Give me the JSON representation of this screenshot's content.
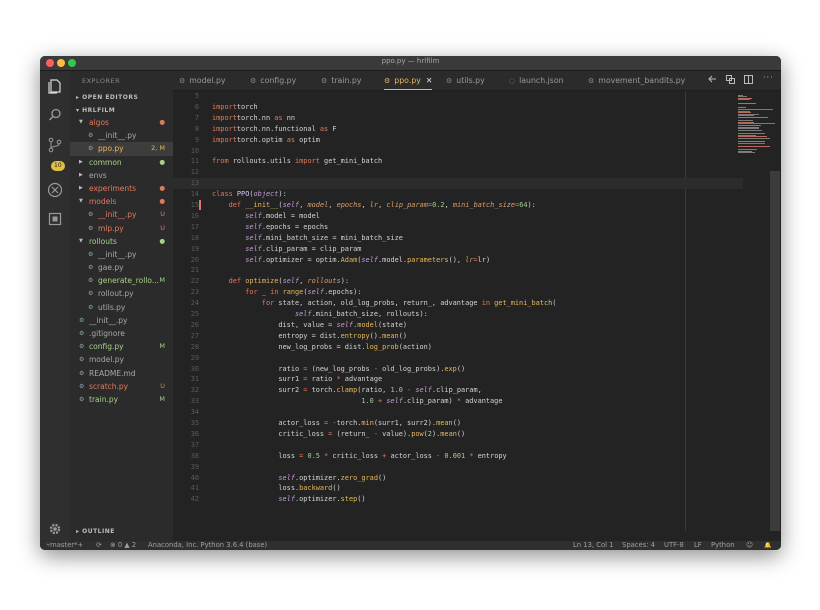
{
  "window": {
    "title": "ppo.py — hrlfilm"
  },
  "traffic_lights": {
    "close": "#fc605c",
    "minimize": "#fdbc40",
    "maximize": "#34c84a"
  },
  "activity_bar": {
    "icons": [
      "files-icon",
      "search-icon",
      "source-control-icon",
      "debug-icon",
      "extensions-icon",
      "settings-gear-icon"
    ],
    "scm_badge": "10"
  },
  "sidebar": {
    "explorer_title": "EXPLORER",
    "open_editors": "OPEN EDITORS",
    "project": "HRLFILM",
    "outline": "OUTLINE",
    "items": [
      {
        "name": "algos",
        "type": "folder",
        "open": true,
        "indent": 1,
        "color": "#e07a5f",
        "status": "●",
        "status_color": "#e07a5f"
      },
      {
        "name": "__init__.py",
        "type": "file",
        "indent": 2,
        "color": "#a8a8a8",
        "status": "",
        "status_color": ""
      },
      {
        "name": "ppo.py",
        "type": "file",
        "indent": 2,
        "color": "#e6b85c",
        "status": "2, M",
        "status_color": "#e6b85c",
        "selected": true
      },
      {
        "name": "common",
        "type": "folder",
        "open": false,
        "indent": 1,
        "color": "#a6d189",
        "status": "●",
        "status_color": "#a6d189"
      },
      {
        "name": "envs",
        "type": "folder",
        "open": false,
        "indent": 1,
        "color": "#a8a8a8",
        "status": "",
        "status_color": ""
      },
      {
        "name": "experiments",
        "type": "folder",
        "open": false,
        "indent": 1,
        "color": "#e07a5f",
        "status": "●",
        "status_color": "#e07a5f"
      },
      {
        "name": "models",
        "type": "folder",
        "open": true,
        "indent": 1,
        "color": "#e07a5f",
        "status": "●",
        "status_color": "#e07a5f"
      },
      {
        "name": "__init__.py",
        "type": "file",
        "indent": 2,
        "color": "#e07a5f",
        "status": "U",
        "status_color": "#e07a5f"
      },
      {
        "name": "mlp.py",
        "type": "file",
        "indent": 2,
        "color": "#e07a5f",
        "status": "U",
        "status_color": "#e07a5f"
      },
      {
        "name": "rollouts",
        "type": "folder",
        "open": true,
        "indent": 1,
        "color": "#a6d189",
        "status": "●",
        "status_color": "#a6d189"
      },
      {
        "name": "__init__.py",
        "type": "file",
        "indent": 2,
        "color": "#a8a8a8",
        "status": "",
        "status_color": ""
      },
      {
        "name": "gae.py",
        "type": "file",
        "indent": 2,
        "color": "#a8a8a8",
        "status": "",
        "status_color": ""
      },
      {
        "name": "generate_rollo...",
        "type": "file",
        "indent": 2,
        "color": "#a6d189",
        "status": "M",
        "status_color": "#a6d189"
      },
      {
        "name": "rollout.py",
        "type": "file",
        "indent": 2,
        "color": "#a8a8a8",
        "status": "",
        "status_color": ""
      },
      {
        "name": "utils.py",
        "type": "file",
        "indent": 2,
        "color": "#a8a8a8",
        "status": "",
        "status_color": ""
      },
      {
        "name": "__init__.py",
        "type": "file",
        "indent": 1,
        "color": "#a8a8a8",
        "status": "",
        "status_color": ""
      },
      {
        "name": ".gitignore",
        "type": "file",
        "indent": 1,
        "color": "#a8a8a8",
        "status": "",
        "status_color": ""
      },
      {
        "name": "config.py",
        "type": "file",
        "indent": 1,
        "color": "#a6d189",
        "status": "M",
        "status_color": "#a6d189"
      },
      {
        "name": "model.py",
        "type": "file",
        "indent": 1,
        "color": "#a8a8a8",
        "status": "",
        "status_color": ""
      },
      {
        "name": "README.md",
        "type": "file",
        "indent": 1,
        "color": "#a8a8a8",
        "status": "",
        "status_color": ""
      },
      {
        "name": "scratch.py",
        "type": "file",
        "indent": 1,
        "color": "#e07a5f",
        "status": "U",
        "status_color": "#e07a5f"
      },
      {
        "name": "train.py",
        "type": "file",
        "indent": 1,
        "color": "#a6d189",
        "status": "M",
        "status_color": "#a6d189"
      }
    ]
  },
  "tabs": [
    {
      "label": "model.py",
      "active": false
    },
    {
      "label": "config.py",
      "active": false
    },
    {
      "label": "train.py",
      "active": false
    },
    {
      "label": "ppo.py",
      "active": true
    },
    {
      "label": "utils.py",
      "active": false
    },
    {
      "label": "launch.json",
      "active": false
    },
    {
      "label": "movement_bandits.py",
      "active": false
    }
  ],
  "tab_actions": [
    "more-tab-icon",
    "open-changes-icon",
    "split-editor-icon",
    "more-actions-icon"
  ],
  "code": {
    "current_line": 13,
    "modified_lines": [
      15
    ],
    "lines": [
      {
        "n": 5,
        "seg": []
      },
      {
        "n": 6,
        "seg": [
          [
            "kw",
            "import"
          ],
          [
            "",
            "torch"
          ]
        ]
      },
      {
        "n": 7,
        "seg": [
          [
            "kw",
            "import"
          ],
          [
            "",
            "torch.nn "
          ],
          [
            "kw",
            "as"
          ],
          [
            "",
            " nn"
          ]
        ]
      },
      {
        "n": 8,
        "seg": [
          [
            "kw",
            "import"
          ],
          [
            "",
            "torch.nn.functional "
          ],
          [
            "kw",
            "as"
          ],
          [
            "",
            " F"
          ]
        ]
      },
      {
        "n": 9,
        "seg": [
          [
            "kw",
            "import"
          ],
          [
            "",
            "torch.optim "
          ],
          [
            "kw",
            "as"
          ],
          [
            "",
            " optim"
          ]
        ]
      },
      {
        "n": 10,
        "seg": []
      },
      {
        "n": 11,
        "seg": [
          [
            "kw",
            "from"
          ],
          [
            "",
            " rollouts.utils "
          ],
          [
            "kw",
            "import"
          ],
          [
            "",
            " get_mini_batch"
          ]
        ]
      },
      {
        "n": 12,
        "seg": []
      },
      {
        "n": 13,
        "seg": []
      },
      {
        "n": 14,
        "seg": [
          [
            "kw",
            "class"
          ],
          [
            "",
            " "
          ],
          [
            "cl",
            "PPO"
          ],
          [
            "",
            "("
          ],
          [
            "sf",
            "object"
          ],
          [
            "",
            "):"
          ]
        ]
      },
      {
        "n": 15,
        "seg": [
          [
            "",
            "    "
          ],
          [
            "kw",
            "def"
          ],
          [
            "",
            " "
          ],
          [
            "fn",
            "__init__"
          ],
          [
            "",
            "("
          ],
          [
            "sf",
            "self"
          ],
          [
            "",
            ", "
          ],
          [
            "pm",
            "model"
          ],
          [
            "",
            ", "
          ],
          [
            "pm",
            "epochs"
          ],
          [
            "",
            ", "
          ],
          [
            "pm",
            "lr"
          ],
          [
            "",
            ", "
          ],
          [
            "pm",
            "clip_param"
          ],
          [
            "op",
            "="
          ],
          [
            "nm",
            "0.2"
          ],
          [
            "",
            ", "
          ],
          [
            "pm",
            "mini_batch_size"
          ],
          [
            "op",
            "="
          ],
          [
            "nm",
            "64"
          ],
          [
            "",
            "):"
          ]
        ]
      },
      {
        "n": 16,
        "seg": [
          [
            "",
            "        "
          ],
          [
            "sf",
            "self"
          ],
          [
            "",
            ".model = model"
          ]
        ]
      },
      {
        "n": 17,
        "seg": [
          [
            "",
            "        "
          ],
          [
            "sf",
            "self"
          ],
          [
            "",
            ".epochs = epochs"
          ]
        ]
      },
      {
        "n": 18,
        "seg": [
          [
            "",
            "        "
          ],
          [
            "sf",
            "self"
          ],
          [
            "",
            ".mini_batch_size = mini_batch_size"
          ]
        ]
      },
      {
        "n": 19,
        "seg": [
          [
            "",
            "        "
          ],
          [
            "sf",
            "self"
          ],
          [
            "",
            ".clip_param = clip_param"
          ]
        ]
      },
      {
        "n": 20,
        "seg": [
          [
            "",
            "        "
          ],
          [
            "sf",
            "self"
          ],
          [
            "",
            ".optimizer = optim."
          ],
          [
            "fn",
            "Adam"
          ],
          [
            "",
            "("
          ],
          [
            "sf",
            "self"
          ],
          [
            "",
            ".model."
          ],
          [
            "fn",
            "parameters"
          ],
          [
            "",
            "(), "
          ],
          [
            "pm",
            "lr"
          ],
          [
            "op",
            "="
          ],
          [
            "",
            "lr)"
          ]
        ]
      },
      {
        "n": 21,
        "seg": []
      },
      {
        "n": 22,
        "seg": [
          [
            "",
            "    "
          ],
          [
            "kw",
            "def"
          ],
          [
            "",
            " "
          ],
          [
            "fn",
            "optimize"
          ],
          [
            "",
            "("
          ],
          [
            "sf",
            "self"
          ],
          [
            "",
            ", "
          ],
          [
            "pm",
            "rollouts"
          ],
          [
            "",
            "):"
          ]
        ]
      },
      {
        "n": 23,
        "seg": [
          [
            "",
            "        "
          ],
          [
            "kw",
            "for"
          ],
          [
            "",
            " _ "
          ],
          [
            "kw",
            "in"
          ],
          [
            "",
            " "
          ],
          [
            "fn",
            "range"
          ],
          [
            "",
            "("
          ],
          [
            "sf",
            "self"
          ],
          [
            "",
            ".epochs):"
          ]
        ]
      },
      {
        "n": 24,
        "seg": [
          [
            "",
            "            "
          ],
          [
            "kw",
            "for"
          ],
          [
            "",
            " state, action, old_log_probs, return_, advantage "
          ],
          [
            "kw",
            "in"
          ],
          [
            "",
            " "
          ],
          [
            "fn",
            "get_mini_batch"
          ],
          [
            "",
            "("
          ]
        ]
      },
      {
        "n": 25,
        "seg": [
          [
            "",
            "                    "
          ],
          [
            "sf",
            "self"
          ],
          [
            "",
            ".mini_batch_size, rollouts):"
          ]
        ]
      },
      {
        "n": 26,
        "seg": [
          [
            "",
            "                dist, value = "
          ],
          [
            "sf",
            "self"
          ],
          [
            "",
            "."
          ],
          [
            "fn",
            "model"
          ],
          [
            "",
            "(state)"
          ]
        ]
      },
      {
        "n": 27,
        "seg": [
          [
            "",
            "                entropy = dist."
          ],
          [
            "fn",
            "entropy"
          ],
          [
            "",
            "()."
          ],
          [
            "fn",
            "mean"
          ],
          [
            "",
            "()"
          ]
        ]
      },
      {
        "n": 28,
        "seg": [
          [
            "",
            "                new_log_probs = dist."
          ],
          [
            "fn",
            "log_prob"
          ],
          [
            "",
            "(action)"
          ]
        ]
      },
      {
        "n": 29,
        "seg": []
      },
      {
        "n": 30,
        "seg": [
          [
            "",
            "                ratio "
          ],
          [
            "op",
            "="
          ],
          [
            "",
            " (new_log_probs "
          ],
          [
            "op",
            "-"
          ],
          [
            "",
            " old_log_probs)."
          ],
          [
            "fn",
            "exp"
          ],
          [
            "",
            "()"
          ]
        ]
      },
      {
        "n": 31,
        "seg": [
          [
            "",
            "                surr1 "
          ],
          [
            "op",
            "="
          ],
          [
            "",
            " ratio "
          ],
          [
            "op",
            "*"
          ],
          [
            "",
            " advantage"
          ]
        ]
      },
      {
        "n": 32,
        "seg": [
          [
            "",
            "                surr2 "
          ],
          [
            "op",
            "="
          ],
          [
            "",
            " torch."
          ],
          [
            "fn",
            "clamp"
          ],
          [
            "",
            "(ratio, "
          ],
          [
            "nm",
            "1.0"
          ],
          [
            "",
            " "
          ],
          [
            "op",
            "-"
          ],
          [
            "",
            " "
          ],
          [
            "sf",
            "self"
          ],
          [
            "",
            ".clip_param,"
          ]
        ]
      },
      {
        "n": 33,
        "seg": [
          [
            "",
            "                                    "
          ],
          [
            "nm",
            "1.0"
          ],
          [
            "",
            " "
          ],
          [
            "op",
            "+"
          ],
          [
            "",
            " "
          ],
          [
            "sf",
            "self"
          ],
          [
            "",
            ".clip_param) "
          ],
          [
            "op",
            "*"
          ],
          [
            "",
            " advantage"
          ]
        ]
      },
      {
        "n": 34,
        "seg": []
      },
      {
        "n": 35,
        "seg": [
          [
            "",
            "                actor_loss "
          ],
          [
            "op",
            "="
          ],
          [
            "",
            " "
          ],
          [
            "op",
            "-"
          ],
          [
            "",
            "torch."
          ],
          [
            "fn",
            "min"
          ],
          [
            "",
            "(surr1, surr2)."
          ],
          [
            "fn",
            "mean"
          ],
          [
            "",
            "()"
          ]
        ]
      },
      {
        "n": 36,
        "seg": [
          [
            "",
            "                critic_loss "
          ],
          [
            "op",
            "="
          ],
          [
            "",
            " (return_ "
          ],
          [
            "op",
            "-"
          ],
          [
            "",
            " value)."
          ],
          [
            "fn",
            "pow"
          ],
          [
            "",
            "("
          ],
          [
            "nm",
            "2"
          ],
          [
            "",
            ")."
          ],
          [
            "fn",
            "mean"
          ],
          [
            "",
            "()"
          ]
        ]
      },
      {
        "n": 37,
        "seg": []
      },
      {
        "n": 38,
        "seg": [
          [
            "",
            "                loss "
          ],
          [
            "op",
            "="
          ],
          [
            "",
            " "
          ],
          [
            "nm",
            "0.5"
          ],
          [
            "",
            " "
          ],
          [
            "op",
            "*"
          ],
          [
            "",
            " critic_loss "
          ],
          [
            "op",
            "+"
          ],
          [
            "",
            " actor_loss "
          ],
          [
            "op",
            "-"
          ],
          [
            "",
            " "
          ],
          [
            "nm",
            "0.001"
          ],
          [
            "",
            " "
          ],
          [
            "op",
            "*"
          ],
          [
            "",
            " entropy"
          ]
        ]
      },
      {
        "n": 39,
        "seg": []
      },
      {
        "n": 40,
        "seg": [
          [
            "",
            "                "
          ],
          [
            "sf",
            "self"
          ],
          [
            "",
            ".optimizer."
          ],
          [
            "fn",
            "zero_grad"
          ],
          [
            "",
            "()"
          ]
        ]
      },
      {
        "n": 41,
        "seg": [
          [
            "",
            "                loss."
          ],
          [
            "fn",
            "backward"
          ],
          [
            "",
            "()"
          ]
        ]
      },
      {
        "n": 42,
        "seg": [
          [
            "",
            "                "
          ],
          [
            "sf",
            "self"
          ],
          [
            "",
            ".optimizer."
          ],
          [
            "fn",
            "step"
          ],
          [
            "",
            "()"
          ]
        ]
      }
    ]
  },
  "statusbar": {
    "branch": "master*+",
    "sync": "⟳",
    "problems": "⊗ 0 ▲ 2",
    "interpreter": "Anaconda, Inc. Python 3.6.4 (base)",
    "position": "Ln 13, Col 1",
    "spaces": "Spaces: 4",
    "encoding": "UTF-8",
    "eol": "LF",
    "language": "Python",
    "feedback": "☺",
    "notifications": "🔔"
  }
}
